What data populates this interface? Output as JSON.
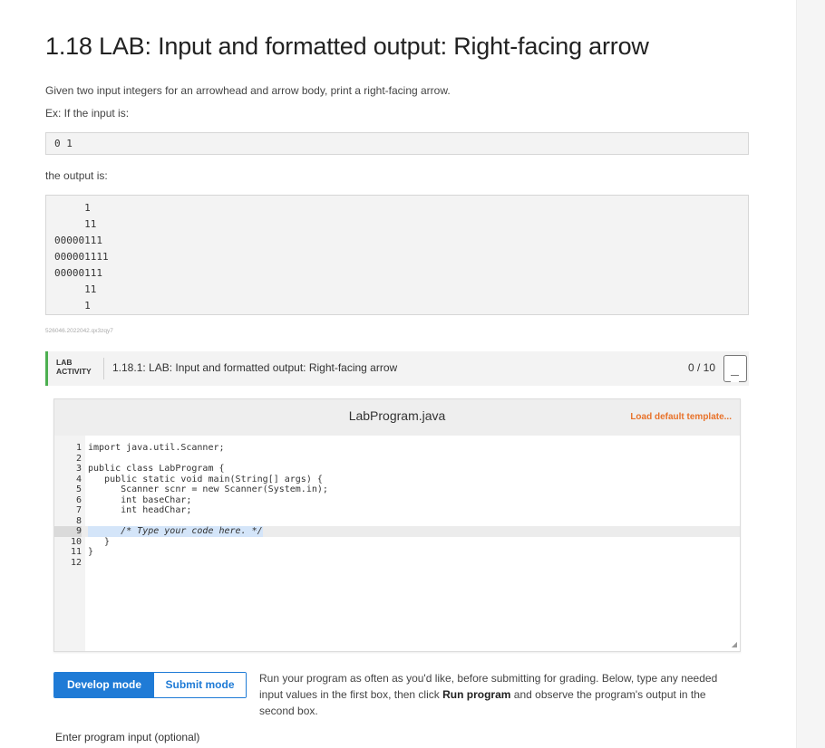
{
  "page": {
    "title": "1.18 LAB: Input and formatted output: Right-facing arrow",
    "intro": "Given two input integers for an arrowhead and arrow body, print a right-facing arrow.",
    "example_label": "Ex: If the input is:",
    "example_input": [
      "0 1"
    ],
    "output_label": "the output is:",
    "example_output": [
      "     1",
      "     11",
      "00000111",
      "000001111",
      "00000111",
      "     11",
      "     1"
    ],
    "content_id": "526046.2022042.qx3zqy7"
  },
  "lab": {
    "tag_line1": "LAB",
    "tag_line2": "ACTIVITY",
    "title": "1.18.1: LAB: Input and formatted output: Right-facing arrow",
    "score": "0 / 10",
    "editor": {
      "file_name": "LabProgram.java",
      "load_default": "Load default template...",
      "lines": [
        {
          "n": "1",
          "code": "import java.util.Scanner;"
        },
        {
          "n": "2",
          "code": ""
        },
        {
          "n": "3",
          "code": "public class LabProgram {"
        },
        {
          "n": "4",
          "code": "   public static void main(String[] args) {"
        },
        {
          "n": "5",
          "code": "      Scanner scnr = new Scanner(System.in);"
        },
        {
          "n": "6",
          "code": "      int baseChar;"
        },
        {
          "n": "7",
          "code": "      int headChar;"
        },
        {
          "n": "8",
          "code": ""
        },
        {
          "n": "9",
          "code": "      /* Type your code here. */"
        },
        {
          "n": "10",
          "code": "   }"
        },
        {
          "n": "11",
          "code": "}"
        },
        {
          "n": "12",
          "code": ""
        }
      ]
    },
    "modes": {
      "develop": "Develop mode",
      "submit": "Submit mode",
      "active": "develop"
    },
    "help": {
      "part1": "Run your program as often as you'd like, before submitting for grading. Below, type any needed input values in the first box, then click ",
      "bold": "Run program",
      "part2": " and observe the program's output in the second box."
    },
    "input_label": "Enter program input (optional)"
  },
  "colors": {
    "accent_blue": "#1f7bd6",
    "accent_green": "#4caf50",
    "link_orange": "#e8722a"
  }
}
